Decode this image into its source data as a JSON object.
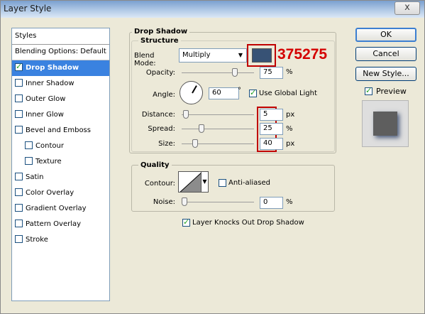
{
  "window": {
    "title": "Layer Style",
    "close_glyph": "x"
  },
  "styles_panel": {
    "header": "Styles",
    "items": [
      {
        "label": "Blending Options: Default",
        "checkbox": false,
        "checked": false,
        "selected": false
      },
      {
        "label": "Drop Shadow",
        "checkbox": true,
        "checked": true,
        "selected": true
      },
      {
        "label": "Inner Shadow",
        "checkbox": true,
        "checked": false,
        "selected": false
      },
      {
        "label": "Outer Glow",
        "checkbox": true,
        "checked": false,
        "selected": false
      },
      {
        "label": "Inner Glow",
        "checkbox": true,
        "checked": false,
        "selected": false
      },
      {
        "label": "Bevel and Emboss",
        "checkbox": true,
        "checked": false,
        "selected": false
      },
      {
        "label": "Contour",
        "checkbox": true,
        "checked": false,
        "selected": false
      },
      {
        "label": "Texture",
        "checkbox": true,
        "checked": false,
        "selected": false
      },
      {
        "label": "Satin",
        "checkbox": true,
        "checked": false,
        "selected": false
      },
      {
        "label": "Color Overlay",
        "checkbox": true,
        "checked": false,
        "selected": false
      },
      {
        "label": "Gradient Overlay",
        "checkbox": true,
        "checked": false,
        "selected": false
      },
      {
        "label": "Pattern Overlay",
        "checkbox": true,
        "checked": false,
        "selected": false
      },
      {
        "label": "Stroke",
        "checkbox": true,
        "checked": false,
        "selected": false
      }
    ]
  },
  "drop_shadow": {
    "title": "Drop Shadow",
    "structure": {
      "title": "Structure",
      "blend_mode_label": "Blend Mode:",
      "blend_mode_value": "Multiply",
      "shadow_color": "#375275",
      "color_annotation": "375275",
      "opacity_label": "Opacity:",
      "opacity_value": "75",
      "opacity_unit": "%",
      "opacity_level": 0.75,
      "angle_label": "Angle:",
      "angle_value": "60",
      "angle_unit": "°",
      "use_global_light_label": "Use Global Light",
      "use_global_light": true,
      "distance_label": "Distance:",
      "distance_value": "5",
      "distance_unit": "px",
      "distance_level": 0.02,
      "spread_label": "Spread:",
      "spread_value": "25",
      "spread_unit": "%",
      "spread_level": 0.25,
      "size_label": "Size:",
      "size_value": "40",
      "size_unit": "px",
      "size_level": 0.16
    },
    "quality": {
      "title": "Quality",
      "contour_label": "Contour:",
      "anti_aliased_label": "Anti-aliased",
      "anti_aliased": false,
      "noise_label": "Noise:",
      "noise_value": "0",
      "noise_unit": "%",
      "noise_level": 0
    },
    "knockout_label": "Layer Knocks Out Drop Shadow",
    "knockout": true
  },
  "buttons": {
    "ok": "OK",
    "cancel": "Cancel",
    "new_style": "New Style...",
    "preview_label": "Preview",
    "preview_checked": true
  },
  "colors": {
    "selection": "#3a82e0",
    "annotation_red": "#d40000",
    "accent_border": "#c00000"
  }
}
